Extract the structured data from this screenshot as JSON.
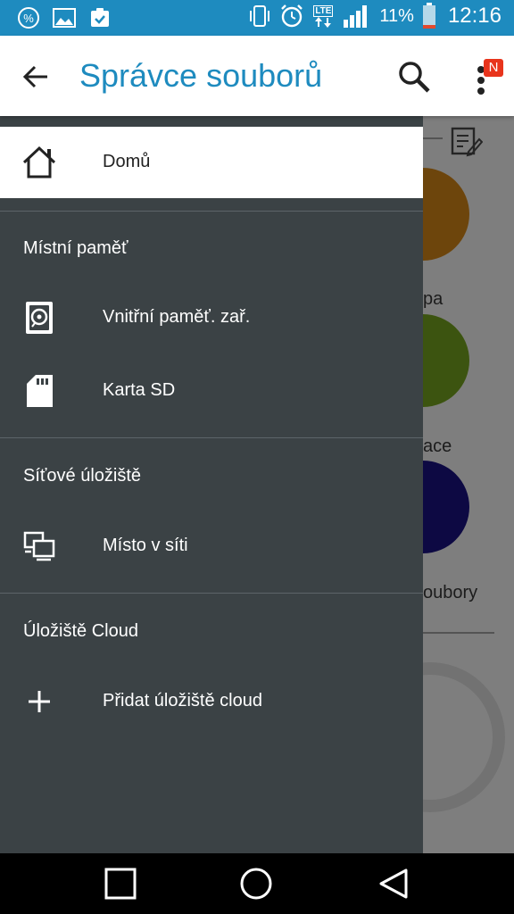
{
  "status_bar": {
    "battery_text": "11%",
    "time": "12:16",
    "network_label": "LTE",
    "icons": [
      "percent-icon",
      "image-icon",
      "clipboard-check-icon",
      "vibrate-icon",
      "alarm-icon",
      "lte-icon",
      "signal-icon",
      "battery-icon"
    ]
  },
  "app_bar": {
    "title": "Správce souborů",
    "notification_badge": "N",
    "accent": "#1e8bbf"
  },
  "drawer": {
    "home_label": "Domů",
    "local_section_title": "Místní paměť",
    "internal_storage_label": "Vnitřní paměť. zař.",
    "sd_card_label": "Karta SD",
    "network_section_title": "Síťové úložiště",
    "network_place_label": "Místo v síti",
    "cloud_section_title": "Úložiště Cloud",
    "add_cloud_label": "Přidat úložiště cloud",
    "background": "#3b4245"
  },
  "background": {
    "label_1": "pa",
    "label_2": "ace",
    "label_3": "oubory",
    "circle_colors": [
      "#c77e17",
      "#6e9a1e",
      "#19127a"
    ]
  },
  "nav_bar": {
    "buttons": [
      "recents-icon",
      "home-circle-icon",
      "back-triangle-icon"
    ]
  }
}
